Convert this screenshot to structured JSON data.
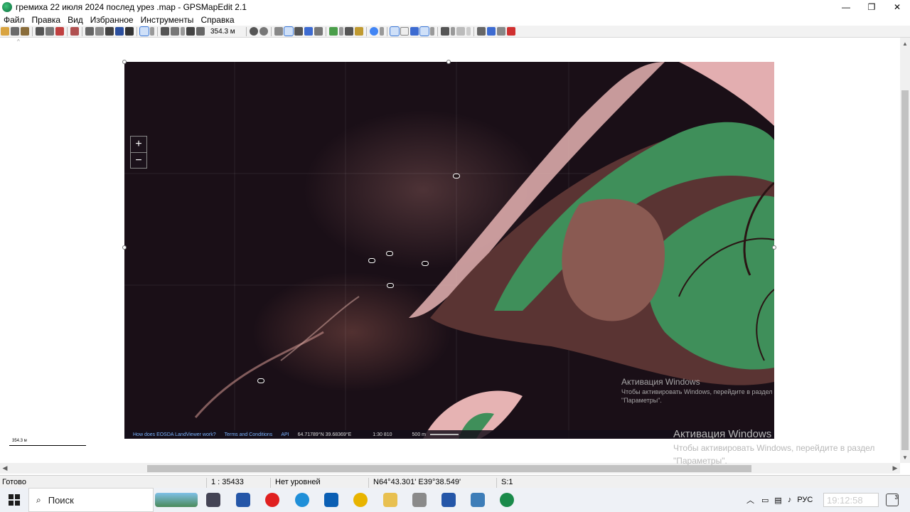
{
  "window": {
    "title": "гремиха 22 июля 2024 послед урез .map - GPSMapEdit 2.1",
    "minimize": "—",
    "restore": "❐",
    "close": "✕"
  },
  "menu": [
    "Файл",
    "Правка",
    "Вид",
    "Избранное",
    "Инструменты",
    "Справка"
  ],
  "toolbar": {
    "scale_value": "354.3 м",
    "icons_group1": [
      "open-icon",
      "save-icon",
      "print-icon",
      "copy-icon",
      "props-icon",
      "undo-icon"
    ],
    "icons_group2": [
      "pan-icon",
      "zoom-rect-icon",
      "select-icon",
      "edit-icon",
      "polyline-icon",
      "draw-icon"
    ],
    "icons_group3": [
      "zoom-in-icon",
      "zoom-out-icon"
    ],
    "icons_group4": [
      "label-icon",
      "grid-icon",
      "waypoint-icon",
      "track-icon"
    ]
  },
  "satellite": {
    "footer": {
      "help_link": "How does EOSDA LandViewer work?",
      "terms_link": "Terms and Conditions",
      "api_link": "API",
      "coords": "64.71789°N 39.68369°E",
      "scale": "1:30 810",
      "distance": "500 m"
    },
    "zoom_in": "+",
    "zoom_out": "−"
  },
  "scalebar": {
    "label": "354.3 м"
  },
  "watermarks": {
    "inner_title": "Активация Windows",
    "inner_sub1": "Чтобы активировать Windows, перейдите в раздел",
    "inner_sub2": "\"Параметры\".",
    "outer_title": "Активация Windows",
    "outer_sub1": "Чтобы активировать Windows, перейдите в раздел",
    "outer_sub2": "\"Параметры\"."
  },
  "statusbar": {
    "status": "Готово",
    "scale": "1 : 35433",
    "levels": "Нет уровней",
    "coords": "N64°43.301' E39°38.549'",
    "s": "S:1"
  },
  "taskbar": {
    "search_label": "Поиск",
    "lang": "РУС",
    "clock": "19:12:58",
    "notifications": "3"
  },
  "colors": {
    "land_green": "#3f8f5a",
    "mudflat_pink": "#e8b8b8",
    "water_dark": "#1a0f17"
  }
}
